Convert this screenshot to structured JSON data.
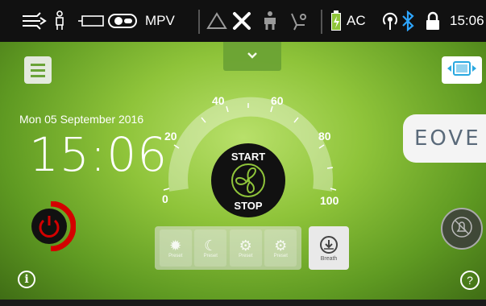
{
  "status_bar": {
    "vehicle_type": "MPV",
    "ac_label": "AC",
    "time": "15:06",
    "icons": [
      "airflow-icon",
      "seat-icon",
      "battery-outline-icon",
      "toggle-icon",
      "warning-triangle-icon",
      "tools-icon",
      "person-seat-icon",
      "seat-recline-icon",
      "battery-charging-icon",
      "signal-icon",
      "bluetooth-icon",
      "lock-icon"
    ]
  },
  "home": {
    "date": "Mon 05 September 2016",
    "clock": "15:06",
    "brand": "EOVE"
  },
  "dial": {
    "ticks": [
      "0",
      "20",
      "40",
      "60",
      "80",
      "100"
    ],
    "start_label": "START",
    "stop_label": "STOP"
  },
  "modes": [
    {
      "label": "Preset",
      "icon": "sun-icon"
    },
    {
      "label": "Preset",
      "icon": "moon-icon"
    },
    {
      "label": "Preset",
      "icon": "gear-icon"
    },
    {
      "label": "Preset",
      "icon": "gear-icon"
    }
  ],
  "breath": {
    "label": "Breath",
    "icon": "breath-icon"
  },
  "colors": {
    "accent_green": "#6ba43a",
    "power_red": "#d40000",
    "status_bar": "#111111"
  }
}
